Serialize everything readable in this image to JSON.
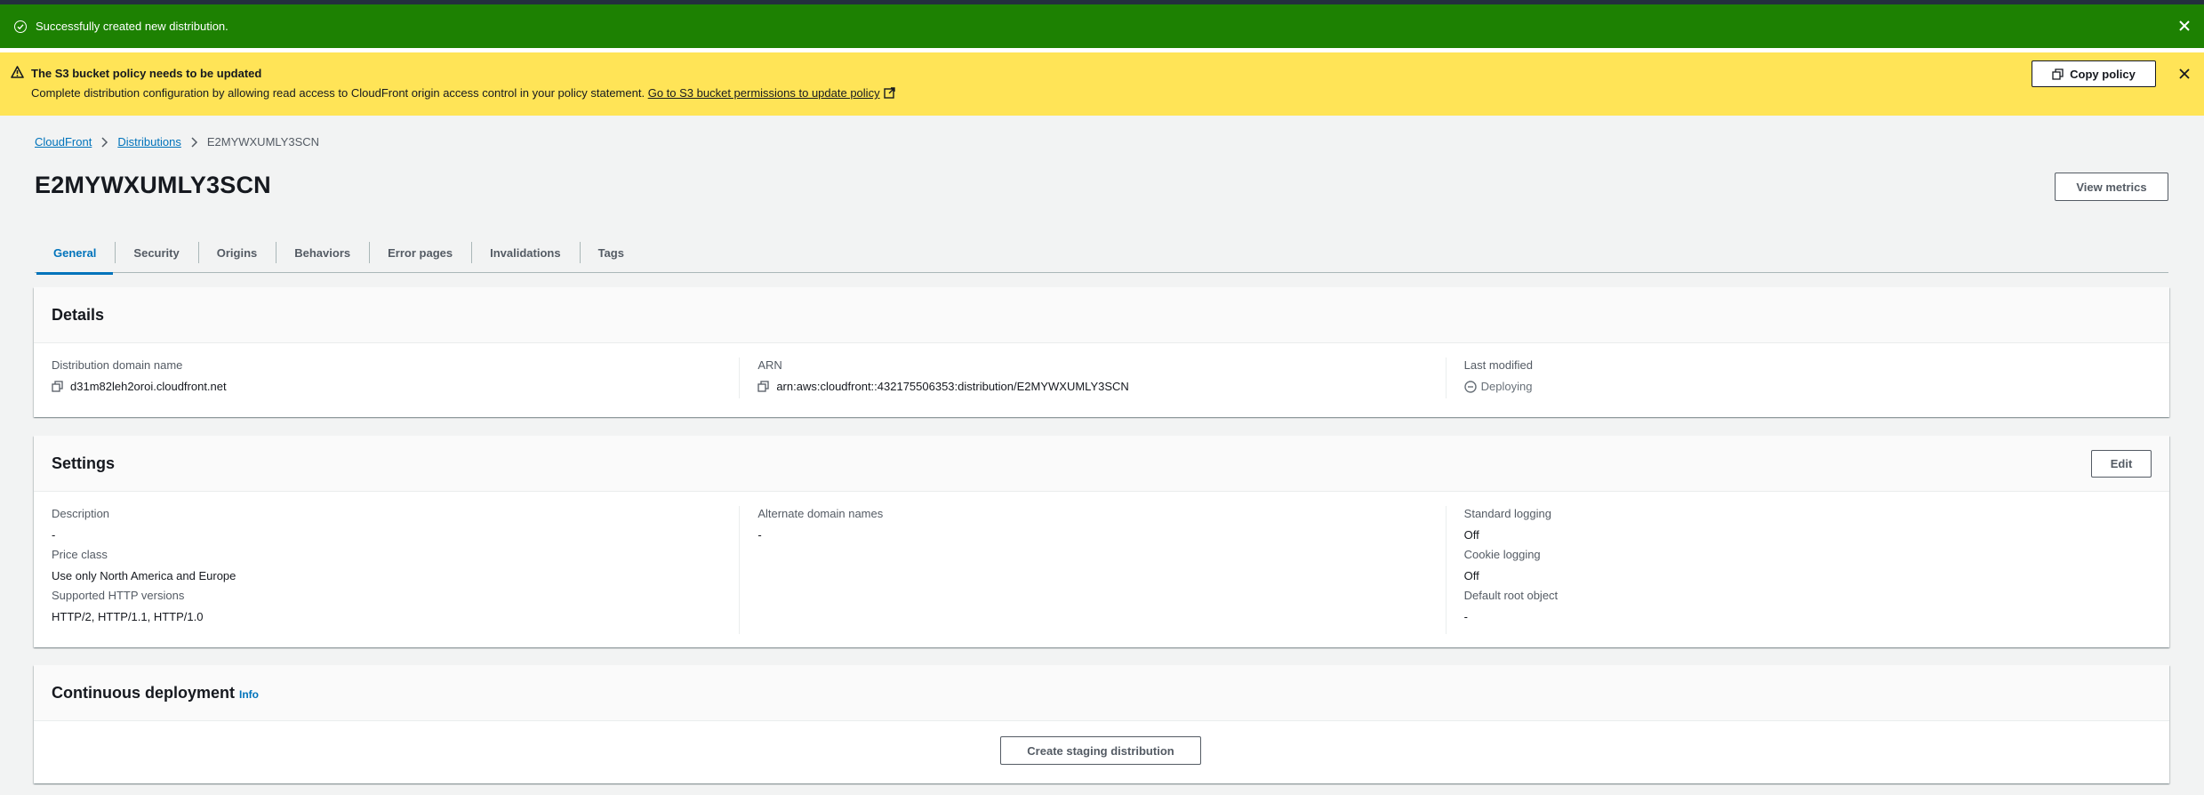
{
  "flash_success": {
    "message": "Successfully created new distribution."
  },
  "flash_warning": {
    "title": "The S3 bucket policy needs to be updated",
    "message": "Complete distribution configuration by allowing read access to CloudFront origin access control in your policy statement.",
    "link": "Go to S3 bucket permissions to update policy",
    "copy_button": "Copy policy"
  },
  "breadcrumb": {
    "items": [
      "CloudFront",
      "Distributions"
    ],
    "current": "E2MYWXUMLY3SCN"
  },
  "page": {
    "title": "E2MYWXUMLY3SCN",
    "view_metrics": "View metrics"
  },
  "tabs": [
    "General",
    "Security",
    "Origins",
    "Behaviors",
    "Error pages",
    "Invalidations",
    "Tags"
  ],
  "details": {
    "title": "Details",
    "domain_label": "Distribution domain name",
    "domain_value": "d31m82leh2oroi.cloudfront.net",
    "arn_label": "ARN",
    "arn_value": "arn:aws:cloudfront::432175506353:distribution/E2MYWXUMLY3SCN",
    "modified_label": "Last modified",
    "modified_value": "Deploying"
  },
  "settings": {
    "title": "Settings",
    "edit": "Edit",
    "description_label": "Description",
    "description_value": "-",
    "price_label": "Price class",
    "price_value": "Use only North America and Europe",
    "http_label": "Supported HTTP versions",
    "http_value": "HTTP/2, HTTP/1.1, HTTP/1.0",
    "alt_label": "Alternate domain names",
    "alt_value": "-",
    "logging_label": "Standard logging",
    "logging_value": "Off",
    "cookie_label": "Cookie logging",
    "cookie_value": "Off",
    "root_label": "Default root object",
    "root_value": "-"
  },
  "continuous": {
    "title": "Continuous deployment",
    "info": "Info",
    "button": "Create staging distribution"
  },
  "colors": {
    "success": "#1d8102",
    "warning": "#ffe457",
    "link": "#0073bb",
    "background": "#f2f3f3"
  }
}
